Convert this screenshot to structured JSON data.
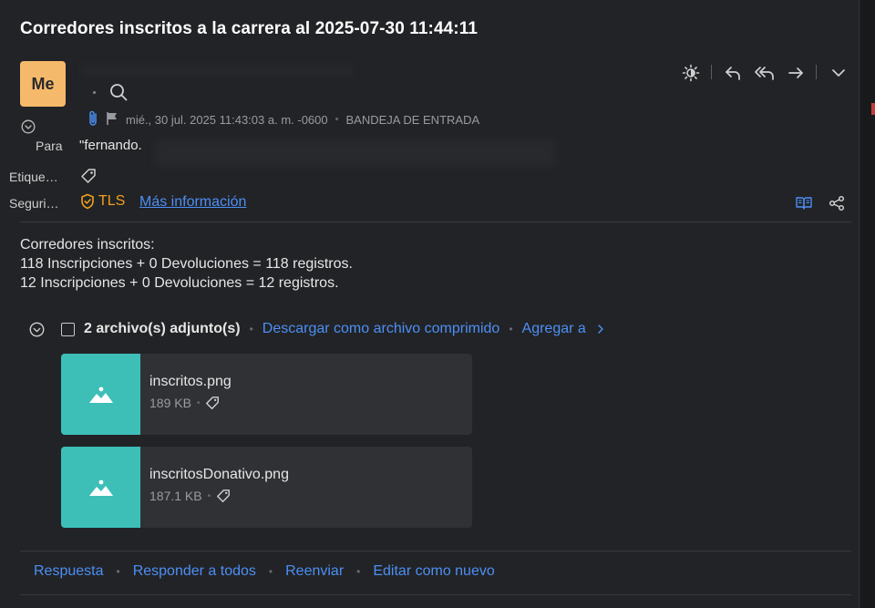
{
  "subject": "Corredores inscritos a la carrera al 2025-07-30 11:44:11",
  "avatar": "Me",
  "header": {
    "date": "mié., 30 jul. 2025 11:43:03 a. m. -0600",
    "folder": "BANDEJA DE ENTRADA"
  },
  "fields": {
    "to_label": "Para",
    "to_value": "\"fernando.",
    "tags_label": "Etique…",
    "security_label": "Seguri…",
    "security_badge": "TLS",
    "more_info": "Más información"
  },
  "body": {
    "line1": "Corredores inscritos:",
    "line2": "118 Inscripciones + 0 Devoluciones = 118 registros.",
    "line3": "12 Inscripciones + 0 Devoluciones = 12 registros."
  },
  "attachments": {
    "count_label": "2 archivo(s) adjunto(s)",
    "download_zip": "Descargar como archivo comprimido",
    "add_to": "Agregar a",
    "items": [
      {
        "name": "inscritos.png",
        "size": "189 KB"
      },
      {
        "name": "inscritosDonativo.png",
        "size": "187.1 KB"
      }
    ]
  },
  "footer": {
    "reply": "Respuesta",
    "reply_all": "Responder a todos",
    "forward": "Reenviar",
    "edit_new": "Editar como nuevo"
  },
  "colors": {
    "accent": "#4c8ff5",
    "tls": "#f0a020",
    "thumb": "#3dbfb8",
    "avatar": "#f5b96b"
  }
}
